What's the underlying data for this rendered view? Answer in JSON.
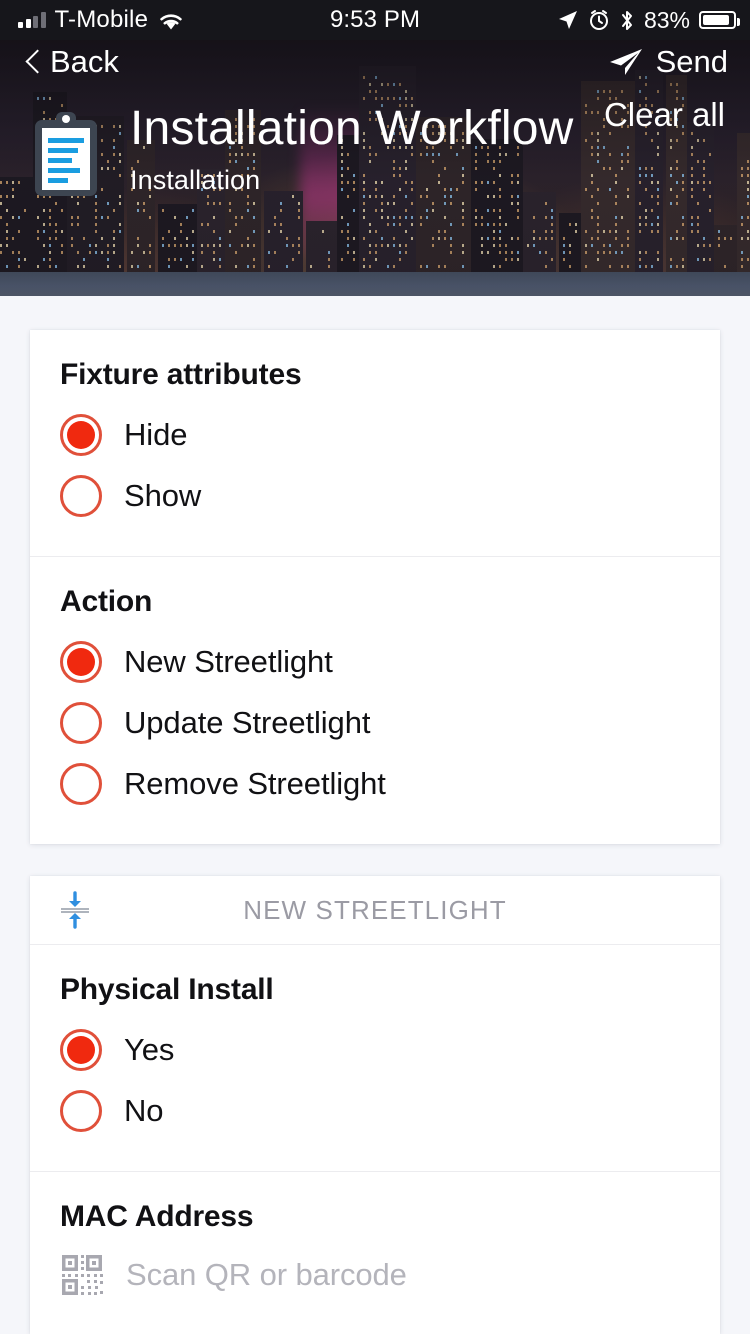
{
  "status_bar": {
    "carrier": "T-Mobile",
    "signal_icon": "signal-bars-icon",
    "wifi_icon": "wifi-icon",
    "time": "9:53 PM",
    "location_icon": "location-arrow-icon",
    "alarm_icon": "alarm-clock-icon",
    "bluetooth_icon": "bluetooth-icon",
    "battery_percent": "83%",
    "battery_icon": "battery-icon"
  },
  "header": {
    "back_label": "Back",
    "back_icon": "chevron-left-icon",
    "send_label": "Send",
    "send_icon": "paper-plane-icon",
    "app_icon": "clipboard-icon",
    "title": "Installation Workflow",
    "subtitle": "Installation",
    "clear_all_label": "Clear all",
    "background_image": "city-skyline-night"
  },
  "colors": {
    "accent_red": "#f0290f",
    "radio_ring": "#e0503a",
    "page_background": "#f5f6fa",
    "card_background": "#ffffff",
    "muted_text": "#9b9ba4",
    "placeholder_text": "#b4b4bb",
    "status_bar_background": "#16161b",
    "collapse_icon_blue": "#2f8fe0"
  },
  "form": {
    "cards": [
      {
        "sections": [
          {
            "title": "Fixture attributes",
            "type": "radio-group",
            "options": [
              {
                "label": "Hide",
                "selected": true
              },
              {
                "label": "Show",
                "selected": false
              }
            ]
          },
          {
            "title": "Action",
            "type": "radio-group",
            "options": [
              {
                "label": "New Streetlight",
                "selected": true
              },
              {
                "label": "Update Streetlight",
                "selected": false
              },
              {
                "label": "Remove Streetlight",
                "selected": false
              }
            ]
          }
        ]
      },
      {
        "group_header": {
          "label": "NEW STREETLIGHT",
          "collapse_icon": "collapse-vertical-icon"
        },
        "sections": [
          {
            "title": "Physical Install",
            "type": "radio-group",
            "options": [
              {
                "label": "Yes",
                "selected": true
              },
              {
                "label": "No",
                "selected": false
              }
            ]
          },
          {
            "title": "MAC Address",
            "type": "scan-input",
            "scan_icon": "qr-code-icon",
            "value": "",
            "placeholder": "Scan QR or barcode"
          }
        ]
      }
    ]
  }
}
